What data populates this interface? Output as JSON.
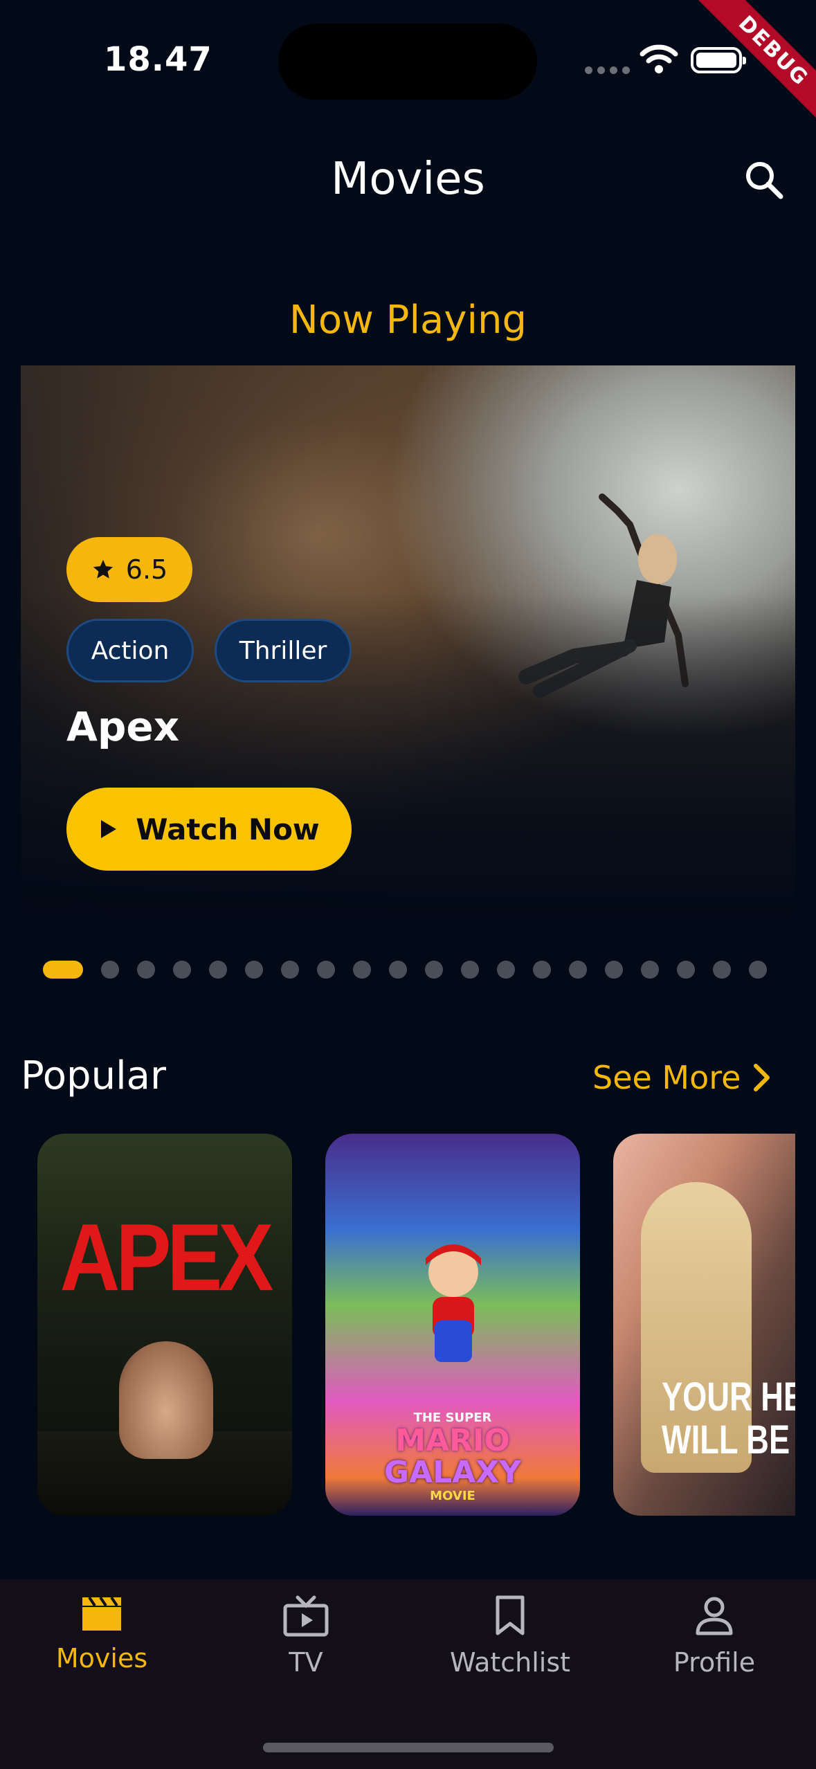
{
  "status_bar": {
    "time": "18.47",
    "debug_label": "DEBUG"
  },
  "header": {
    "title": "Movies"
  },
  "now_playing": {
    "section_title": "Now Playing",
    "rating": "6.5",
    "genres": [
      "Action",
      "Thriller"
    ],
    "movie_title": "Apex",
    "watch_label": "Watch Now",
    "page_count": 20,
    "active_page": 1
  },
  "popular": {
    "section_title": "Popular",
    "see_more_label": "See More",
    "posters": [
      {
        "title_text": "APEX"
      },
      {
        "title_small": "THE SUPER",
        "title_line1": "MARIO",
        "title_line2": "GALAXY",
        "title_small2": "MOVIE"
      },
      {
        "title_line1": "YOUR HEA",
        "title_line2": "WILL BE BRO"
      }
    ]
  },
  "bottom_nav": {
    "items": [
      {
        "label": "Movies",
        "icon": "clapperboard-icon",
        "active": true
      },
      {
        "label": "TV",
        "icon": "tv-icon",
        "active": false
      },
      {
        "label": "Watchlist",
        "icon": "bookmark-icon",
        "active": false
      },
      {
        "label": "Profile",
        "icon": "person-icon",
        "active": false
      }
    ]
  },
  "colors": {
    "accent": "#f5b70c",
    "background": "#030a17",
    "nav_background": "#120f18",
    "chip": "#0c2c55"
  }
}
